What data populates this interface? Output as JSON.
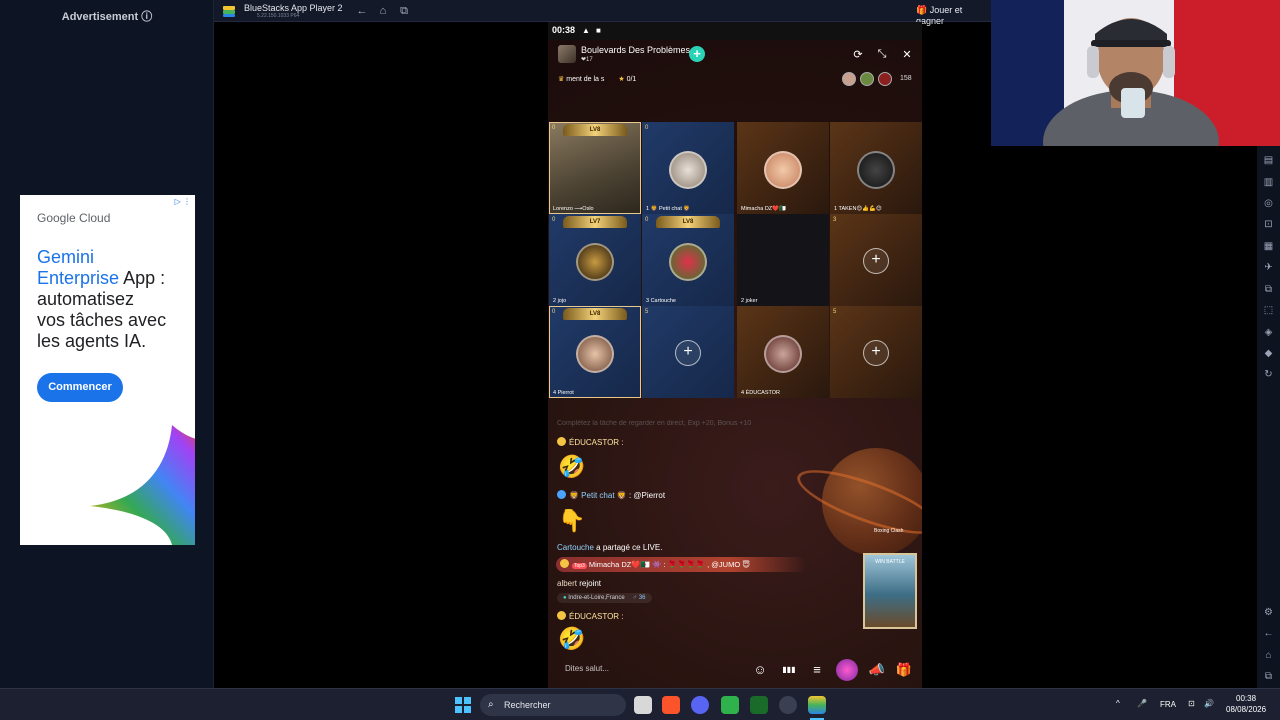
{
  "advertisement": {
    "header": "Advertisement ⓘ",
    "brand_word1": "Google",
    "brand_word2": "Cloud",
    "choices": "▷ ⋮",
    "headline_line1": "Gemini",
    "headline_line2_blue": "Enterprise",
    "headline_line2_rest": "App :",
    "headline_line3": "automatisez",
    "headline_line4": "vos tâches avec",
    "headline_line5": "les agents IA.",
    "cta": "Commencer"
  },
  "bluestacks": {
    "title": "BlueStacks App Player 2",
    "version": "5.22.150.1033 P64",
    "play_label": "Jouer et gagner",
    "play_icon": "🎁"
  },
  "phone": {
    "status_time": "00:38",
    "status_icons": [
      "▲",
      "■"
    ],
    "host_name": "Boulevards Des Problèmes",
    "host_likes": "❤17",
    "follow": "+",
    "top_icons": [
      "⟳",
      "⤡",
      "✕"
    ],
    "marquee": "ment de la s",
    "rank_text": "0/1",
    "viewer_count": "158",
    "seats": [
      {
        "num": "0",
        "label": "Lorenzo ⟶Oslo",
        "wing": "LV8"
      },
      {
        "num": "0",
        "label": "1 🦁 Petit chat 🦁",
        "wing": ""
      },
      {
        "num": "",
        "label": "Mimacha DZ❤️🇩🇿",
        "wing": ""
      },
      {
        "num": "",
        "label": "1 TAKEN😊👍💪😊",
        "wing": ""
      },
      {
        "num": "0",
        "label": "2 jojo",
        "wing": "LV7"
      },
      {
        "num": "0",
        "label": "3 Cartouche",
        "wing": "LV8"
      },
      {
        "num": "",
        "label": "2 joker",
        "wing": ""
      },
      {
        "num": "3",
        "label": "",
        "wing": ""
      },
      {
        "num": "0",
        "label": "4 Pierrot",
        "wing": "LV8"
      },
      {
        "num": "5",
        "label": "",
        "wing": ""
      },
      {
        "num": "",
        "label": "4 ÉDUCASTOR",
        "wing": ""
      },
      {
        "num": "5",
        "label": "",
        "wing": ""
      }
    ],
    "chat": {
      "faded": "Complétez la tâche de regarder en direct, Exp +20, Bonus +10",
      "m1_name": "ÉDUCASTOR :",
      "m2_name": "🦁 Petit chat 🦁",
      "m2_text": " : @Pierrot",
      "m3_name": "Cartouche",
      "m3_text": " a partagé ce LIVE.",
      "m4_tag": "Top3",
      "m4_text": "Mimacha DZ❤️🇩🇿 👾 : 🌹🌹🌹🌹 , @JUMO 😇",
      "m5_name": "albert",
      "m5_text": " rejoint",
      "m5_location": "Indre-et-Loire,France",
      "m5_age": "♂ 36",
      "m6_name": "ÉDUCASTOR :",
      "emoji_laugh": "🤣",
      "emoji_hand": "👇"
    },
    "game_badge": "Boxing Clash",
    "game_card_text": "WIN BATTLE",
    "input_placeholder": "Dites salut...",
    "bar_icons": [
      "☺",
      "▮▮▮",
      "≡",
      "🎁"
    ]
  },
  "taskbar": {
    "search_label": "Rechercher",
    "lang": "FRA",
    "time": "00:38",
    "date": "08/08/2026",
    "tray_icons": [
      "^",
      "🎤",
      "⊡",
      "🔊"
    ]
  },
  "colors": {
    "accent_teal": "#2ad3b6",
    "ad_blue": "#1a73e8",
    "taskbar": "#1c2030"
  }
}
